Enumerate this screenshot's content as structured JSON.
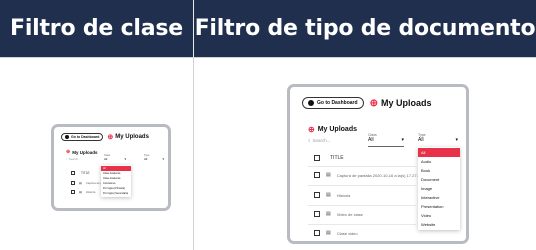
{
  "headers": {
    "left": "Filtro de clase",
    "right": "Filtro de tipo de documento"
  },
  "app": {
    "dashboard_button": "Go to Dashboard",
    "page_title": "My Uploads",
    "section_title": "My Uploads",
    "search_placeholder": "Search..."
  },
  "left_mock": {
    "filter": {
      "label": "Class",
      "value": "All"
    },
    "second_filter": {
      "label": "Type",
      "value": "All"
    },
    "dropdown_options": [
      "All",
      "Clase Academia",
      "Clase Academia",
      "Comisiones",
      "Por Ingles (Primaria)",
      "Por Ingles (Secundaria)"
    ],
    "dropdown_selected_index": 0,
    "table_header": "TITLE",
    "rows": [
      "Captura de pantalla 2020",
      "Historia"
    ]
  },
  "right_mock": {
    "class_filter": {
      "label": "Class",
      "value": "All"
    },
    "type_filter": {
      "label": "Type",
      "value": "All"
    },
    "dropdown_options": [
      "All",
      "Audio",
      "Book",
      "Document",
      "Image",
      "Interactive",
      "Presentation",
      "Video",
      "Website"
    ],
    "dropdown_selected_index": 0,
    "table_header": "TITLE",
    "rows": [
      "Captura de pantalla 2020-10-16 a la(s) 17.27.54",
      "Historia",
      "Video de clase",
      "Clase video"
    ]
  },
  "colors": {
    "header_bg": "#1f2f4d",
    "accent": "#e8324a",
    "mock_border": "#b8bcc2"
  },
  "icons": [
    "upload-icon",
    "checkbox-icon",
    "document-icon",
    "chevron-down-icon",
    "search-icon"
  ]
}
